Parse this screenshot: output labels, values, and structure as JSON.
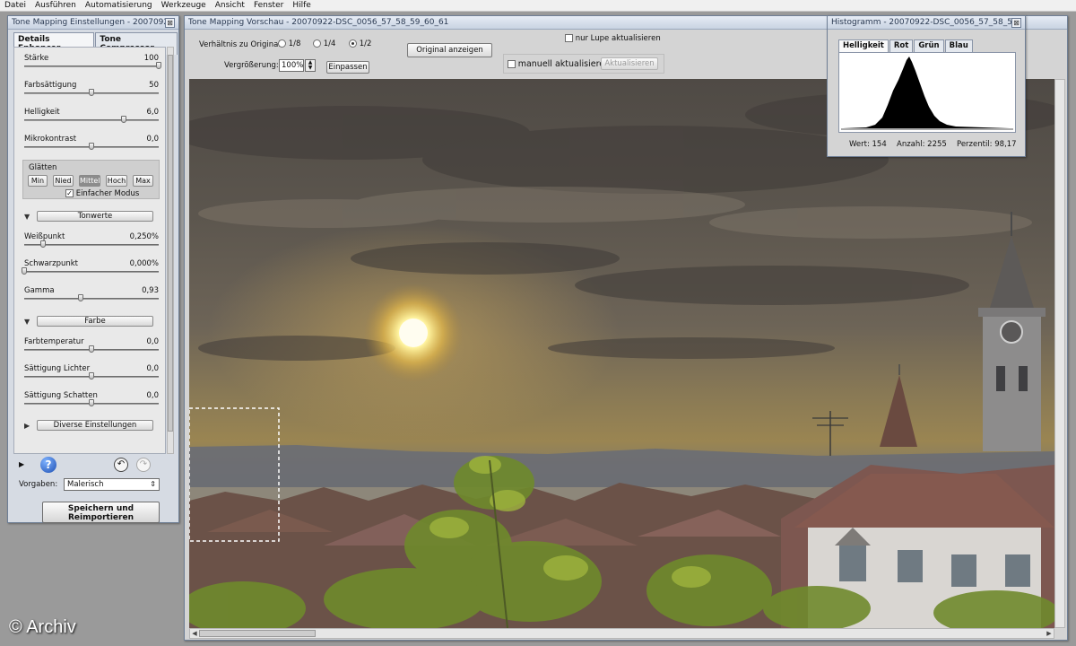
{
  "menubar": [
    "Datei",
    "Ausführen",
    "Automatisierung",
    "Werkzeuge",
    "Ansicht",
    "Fenster",
    "Hilfe"
  ],
  "left_window": {
    "title": "Tone Mapping Einstellungen - 20070922-...",
    "tabs": [
      "Details Enhancer",
      "Tone Compressor"
    ],
    "sliders_top": [
      {
        "label": "Stärke",
        "value": "100",
        "fraction": 1.0
      },
      {
        "label": "Farbsättigung",
        "value": "50",
        "fraction": 0.5
      },
      {
        "label": "Helligkeit",
        "value": "6,0",
        "fraction": 0.74
      },
      {
        "label": "Mikrokontrast",
        "value": "0,0",
        "fraction": 0.5
      }
    ],
    "glaetten": {
      "label": "Glätten",
      "buttons": [
        "Min",
        "Nied",
        "Mittel",
        "Hoch",
        "Max"
      ],
      "active": "Mittel",
      "checkbox_label": "Einfacher Modus",
      "checked": true
    },
    "tonwerte": {
      "button": "Tonwerte",
      "sliders": [
        {
          "label": "Weißpunkt",
          "value": "0,250%",
          "fraction": 0.14
        },
        {
          "label": "Schwarzpunkt",
          "value": "0,000%",
          "fraction": 0.0
        },
        {
          "label": "Gamma",
          "value": "0,93",
          "fraction": 0.42
        }
      ]
    },
    "farbe": {
      "button": "Farbe",
      "sliders": [
        {
          "label": "Farbtemperatur",
          "value": "0,0",
          "fraction": 0.5
        },
        {
          "label": "Sättigung Lichter",
          "value": "0,0",
          "fraction": 0.5
        },
        {
          "label": "Sättigung Schatten",
          "value": "0,0",
          "fraction": 0.5
        }
      ]
    },
    "diverse_button": "Diverse Einstellungen",
    "vorgaben_label": "Vorgaben:",
    "vorgaben_value": "Malerisch",
    "save_button": "Speichern und\nReimportieren"
  },
  "preview_window": {
    "title": "Tone Mapping Vorschau - 20070922-DSC_0056_57_58_59_60_61",
    "ratio_label": "Verhältnis zu Original:",
    "ratio_options": [
      "1/8",
      "1/4",
      "1/2"
    ],
    "ratio_selected": "1/2",
    "original_button": "Original anzeigen",
    "nur_lupe_label": "nur Lupe aktualisieren",
    "zoom_label": "Vergrößerung:",
    "zoom_value": "100%",
    "fit_button": "Einpassen",
    "manual_label": "manuell aktualisieren",
    "update_button": "Aktualisieren"
  },
  "histogram_window": {
    "title": "Histogramm - 20070922-DSC_0056_57_58_59_60...",
    "tabs": [
      "Helligkeit",
      "Rot",
      "Grün",
      "Blau"
    ],
    "active_tab": "Helligkeit",
    "wert": "Wert: 154",
    "anzahl": "Anzahl: 2255",
    "perzentil": "Perzentil: 98,17"
  },
  "watermark": "© Archiv"
}
